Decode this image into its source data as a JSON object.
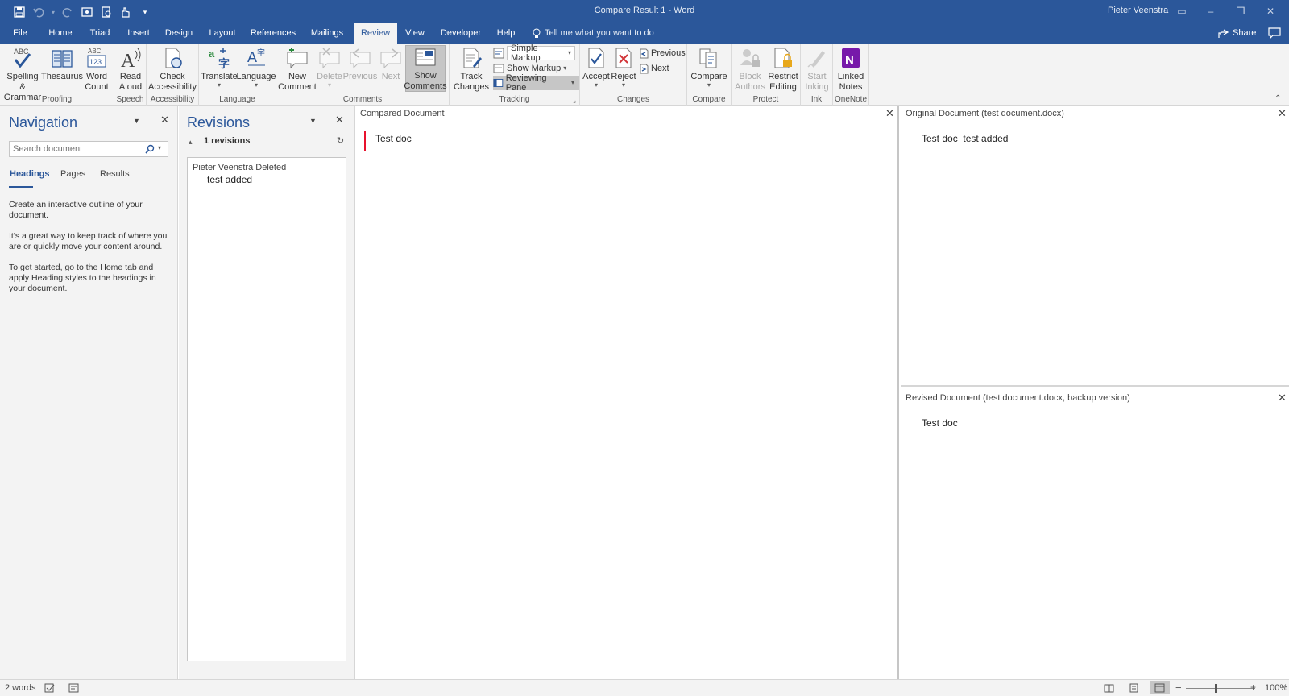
{
  "titlebar": {
    "doc_title": "Compare Result 1 - Word",
    "user": "Pieter Veenstra"
  },
  "tabs": [
    "File",
    "Home",
    "Triad",
    "Insert",
    "Design",
    "Layout",
    "References",
    "Mailings",
    "Review",
    "View",
    "Developer",
    "Help"
  ],
  "active_tab": "Review",
  "tell_me": "Tell me what you want to do",
  "share": "Share",
  "ribbon": {
    "proofing": {
      "spelling": "Spelling &",
      "spelling2": "Grammar",
      "thesaurus": "Thesaurus",
      "wordcount": "Word",
      "wordcount2": "Count",
      "label": "Proofing"
    },
    "speech": {
      "read": "Read",
      "read2": "Aloud",
      "label": "Speech"
    },
    "accessibility": {
      "check": "Check",
      "check2": "Accessibility",
      "label": "Accessibility"
    },
    "language": {
      "translate": "Translate",
      "language": "Language",
      "label": "Language"
    },
    "comments": {
      "new": "New",
      "new2": "Comment",
      "delete": "Delete",
      "previous": "Previous",
      "next": "Next",
      "show": "Show",
      "show2": "Comments",
      "label": "Comments"
    },
    "tracking": {
      "track": "Track",
      "track2": "Changes",
      "simple_markup": "Simple Markup",
      "show_markup": "Show Markup",
      "reviewing_pane": "Reviewing Pane",
      "label": "Tracking"
    },
    "changes": {
      "accept": "Accept",
      "reject": "Reject",
      "previous": "Previous",
      "next": "Next",
      "label": "Changes"
    },
    "compare": {
      "compare": "Compare",
      "label": "Compare"
    },
    "protect": {
      "block": "Block",
      "block2": "Authors",
      "restrict": "Restrict",
      "restrict2": "Editing",
      "label": "Protect"
    },
    "ink": {
      "start": "Start",
      "start2": "Inking",
      "label": "Ink"
    },
    "onenote": {
      "linked": "Linked",
      "linked2": "Notes",
      "label": "OneNote"
    }
  },
  "navigation": {
    "title": "Navigation",
    "search_placeholder": "Search document",
    "tabs": [
      "Headings",
      "Pages",
      "Results"
    ],
    "p1": "Create an interactive outline of your document.",
    "p2": "It's a great way to keep track of where you are or quickly move your content around.",
    "p3": "To get started, go to the Home tab and apply Heading styles to the headings in your document."
  },
  "revisions": {
    "title": "Revisions",
    "count": "1 revisions",
    "items": [
      {
        "author_action": "Pieter Veenstra Deleted",
        "text": "test added"
      }
    ]
  },
  "compared": {
    "header": "Compared Document",
    "text": "Test doc"
  },
  "original": {
    "header": "Original Document (test document.docx)",
    "text1": "Test doc",
    "text2": "test added"
  },
  "revised": {
    "header": "Revised Document (test document.docx, backup version)",
    "text": "Test doc"
  },
  "status": {
    "words": "2 words",
    "zoom": "100%"
  },
  "colors": {
    "accent": "#2b579a",
    "change_bar": "#e8112d",
    "onenote": "#7719aa"
  }
}
